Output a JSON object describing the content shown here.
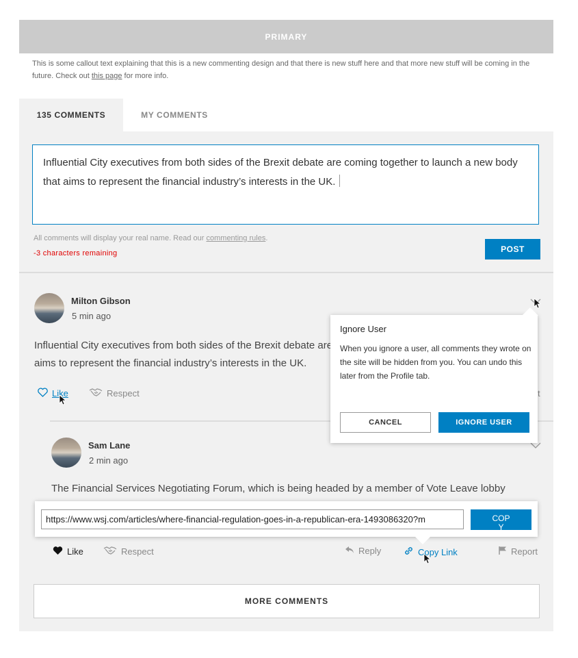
{
  "header": {
    "primary_label": "PRIMARY"
  },
  "callout": {
    "text_before": "This is some callout text explaining that this is a new commenting design and that there is new stuff here and that more new stuff will be coming in the future. Check out ",
    "link_text": "this page",
    "text_after": " for more info."
  },
  "tabs": [
    {
      "label": "135 COMMENTS",
      "active": true
    },
    {
      "label": "MY COMMENTS",
      "active": false
    }
  ],
  "composer": {
    "value": "Influential City executives from both sides of the Brexit debate are coming together to launch a new body that aims to represent the financial industry’s interests in the UK.",
    "rules_prefix": "All comments will display your real name. Read our ",
    "rules_link": "commenting rules",
    "rules_suffix": ".",
    "remaining": "-3 characters remaining",
    "post_label": "POST"
  },
  "comments": [
    {
      "author": "Milton Gibson",
      "time": "5 min ago",
      "body": "Influential City executives from both sides of the Brexit debate are coming together to launch a new body that aims to represent the financial industry’s interests in the UK.",
      "actions": {
        "like": "Like",
        "respect": "Respect"
      }
    },
    {
      "author": "Sam Lane",
      "time": "2 min ago",
      "body": "The Financial Services Negotiating Forum, which is being headed by a member of Vote Leave lobby",
      "actions": {
        "like": "Like",
        "respect": "Respect",
        "reply": "Reply",
        "copy_link": "Copy Link",
        "report": "Report"
      }
    }
  ],
  "ignore_popover": {
    "title": "Ignore User",
    "text": "When you ignore a user, all comments they wrote on the site will be hidden from you. You can undo this later from the Profile tab.",
    "cancel_label": "CANCEL",
    "ignore_label": "IGNORE USER"
  },
  "copy_popover": {
    "url": "https://www.wsj.com/articles/where-financial-regulation-goes-in-a-republican-era-1493086320?m",
    "copy_label": "COP Y"
  },
  "more_comments_label": "MORE COMMENTS",
  "partial_report_label": "t",
  "colors": {
    "accent": "#0080c3",
    "error": "#e00000",
    "panel": "#f1f1f1",
    "header": "#cbcbcb"
  }
}
